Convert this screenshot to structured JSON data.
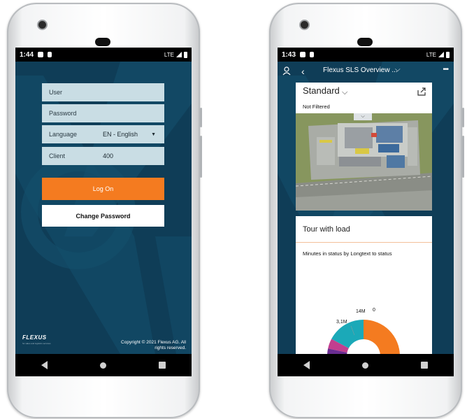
{
  "login_screen": {
    "status_time": "1:44",
    "network": "LTE",
    "fields": {
      "user_placeholder": "User",
      "password_placeholder": "Password",
      "language_label": "Language",
      "language_value": "EN - English",
      "client_label": "Client",
      "client_value": "400"
    },
    "logon_label": "Log On",
    "change_password_label": "Change Password",
    "logo_text": "FLEXUS",
    "logo_tagline": "for sales and logistics services",
    "copyright": "Copyright © 2021 Flexus AG. All rights reserved."
  },
  "dashboard_screen": {
    "status_time": "1:43",
    "network": "LTE",
    "header_title": "Flexus SLS Overview ...",
    "card_standard": {
      "title": "Standard",
      "filter_text": "Not Filtered"
    },
    "card_tour": {
      "title": "Tour with load",
      "subtitle": "Minutes in status by Longtext to status",
      "donut_labels": [
        "3,1M",
        "14M",
        "0"
      ]
    }
  },
  "colors": {
    "brand_dark": "#0f3d57",
    "accent_orange": "#f47b20",
    "field_bg": "#c9dde4",
    "donut_teal": "#1ba9b8",
    "donut_magenta": "#c23e8f",
    "donut_purple": "#6a2d91"
  },
  "icons": [
    "user-icon",
    "back-icon",
    "chevron-down-icon",
    "more-icon",
    "share-icon",
    "nav-back-icon",
    "nav-home-icon",
    "nav-recent-icon"
  ]
}
